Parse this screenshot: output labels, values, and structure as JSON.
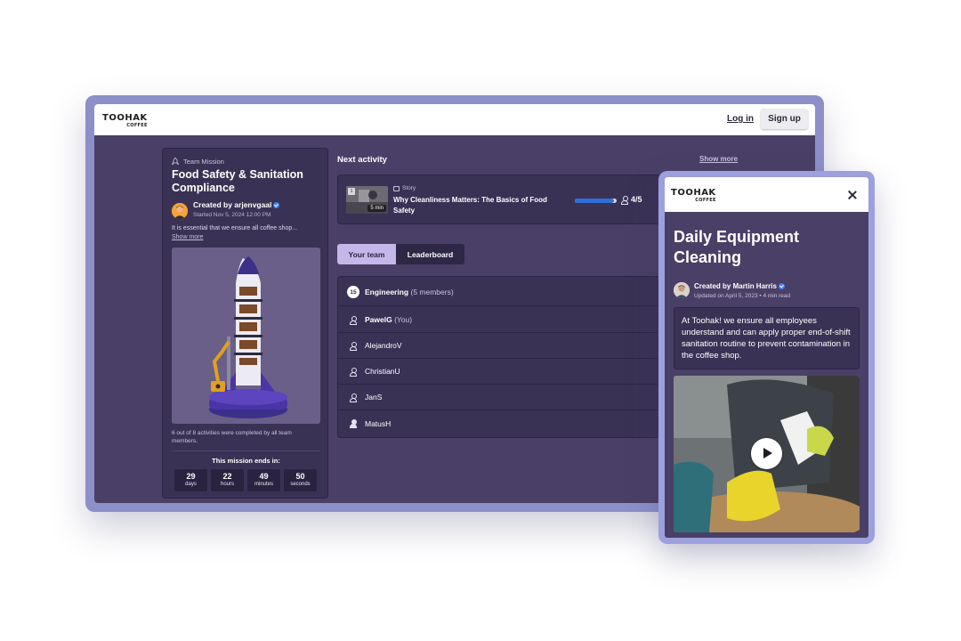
{
  "brand": {
    "name": "TOOHAK",
    "sub": "COFFEE"
  },
  "header": {
    "login_label": "Log in",
    "signup_label": "Sign up"
  },
  "mission": {
    "label": "Team Mission",
    "title": "Food Safety & Sanitation Compliance",
    "creator_prefix": "Created by ",
    "creator": "arjenvgaal",
    "started": "Started Nov 5, 2024 12:00 PM",
    "description": "It is essential that we ensure all coffee shop...",
    "show_more": "Show more",
    "progress_text": "6 out of 8 activities were completed by all team members.",
    "countdown_title": "This mission ends in:",
    "countdown": [
      {
        "value": "29",
        "unit": "days"
      },
      {
        "value": "22",
        "unit": "hours"
      },
      {
        "value": "49",
        "unit": "minutes"
      },
      {
        "value": "50",
        "unit": "seconds"
      }
    ]
  },
  "next_activity": {
    "heading": "Next activity",
    "show_more": "Show more",
    "type": "Story",
    "title": "Why Cleanliness Matters: The Basics of Food Safety",
    "duration": "5 min",
    "thumb_badge": "1",
    "progress_fraction": 0.93,
    "participants": "4/5"
  },
  "tabs": [
    {
      "label": "Your team",
      "active": true
    },
    {
      "label": "Leaderboard",
      "active": false
    }
  ],
  "team": {
    "count": "15",
    "name": "Engineering",
    "members_text": "(5 members)",
    "members": [
      {
        "name": "PawelG",
        "tag": "(You)"
      },
      {
        "name": "AlejandroV",
        "tag": ""
      },
      {
        "name": "ChristianU",
        "tag": ""
      },
      {
        "name": "JanS",
        "tag": ""
      },
      {
        "name": "MatusH",
        "tag": ""
      }
    ]
  },
  "mobile": {
    "title": "Daily Equipment Cleaning",
    "creator_prefix": "Created by ",
    "creator": "Martin Harris",
    "updated": "Updated on April 5, 2023 • 4 min read",
    "description": "At Toohak! we ensure all employees understand and can apply proper end-of-shift sanitation routine to prevent contamination in the coffee shop."
  },
  "colors": {
    "app_bg": "#4a3f66",
    "card_bg": "#3a3254",
    "accent_tab": "#c5b7e9",
    "progress": "#2f6fdb",
    "frame": "#8d8fc8"
  },
  "icons": [
    "rocket-icon",
    "verified-icon",
    "story-icon",
    "user-icon",
    "close-icon",
    "play-icon"
  ]
}
